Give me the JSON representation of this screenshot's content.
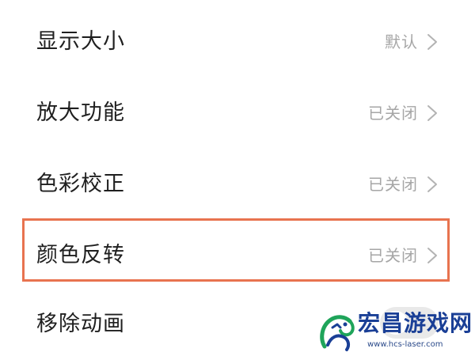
{
  "settings": {
    "items": [
      {
        "label": "显示大小",
        "value": "默认"
      },
      {
        "label": "放大功能",
        "value": "已关闭"
      },
      {
        "label": "色彩校正",
        "value": "已关闭"
      },
      {
        "label": "颜色反转",
        "value": "已关闭"
      },
      {
        "label": "移除动画",
        "toggle_on": false
      }
    ],
    "highlighted_item": "颜色反转"
  },
  "colors": {
    "highlight": "#e8734f",
    "label_text": "#1f1f1f",
    "value_text": "#a6a6a6",
    "watermark_brand": "#1a3f96",
    "watermark_logo_green": "#1fa45a"
  },
  "icons": {
    "chevron": "chevron-right-icon",
    "logo": "dragon-logo-icon"
  },
  "watermark": {
    "name": "宏昌游戏网",
    "url": "www.hcs-laser.com"
  }
}
